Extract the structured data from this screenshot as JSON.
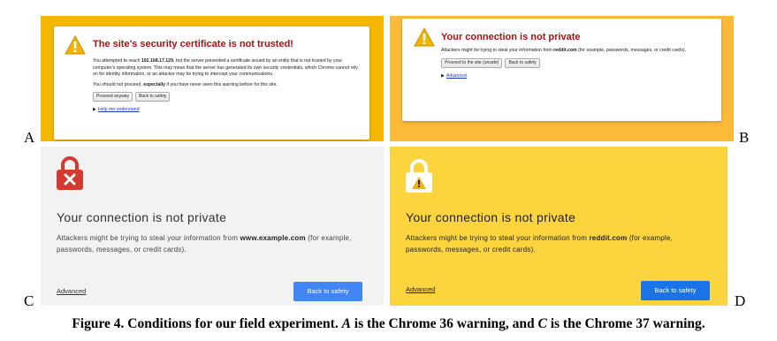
{
  "panels": {
    "a": {
      "title": "The site's security certificate is not trusted!",
      "para1_pre": "You attempted to reach ",
      "para1_ip": "192.168.17.129",
      "para1_post": ", but the server presented a certificate issued by an entity that is not trusted by your computer's operating system. This may mean that the server has generated its own security credentials, which Chrome cannot rely on for identity information, or an attacker may be trying to intercept your communications.",
      "para2_pre": "You should not proceed, ",
      "para2_bold": "especially",
      "para2_post": " if you have never seen this warning before for this site.",
      "proceed_button": "Proceed anyway",
      "back_button": "Back to safety",
      "help_link": "Help me understand"
    },
    "b": {
      "title": "Your connection is not private",
      "body_pre": "Attackers might be trying to steal your information from ",
      "body_site": "reddit.com",
      "body_post": " (for example, passwords, messages, or credit cards).",
      "proceed_button": "Proceed to the site (unsafe)",
      "back_button": "Back to safety",
      "advanced_link": "Advanced"
    },
    "c": {
      "title": "Your connection is not private",
      "body_pre": "Attackers might be trying to steal your information from ",
      "body_site": "www.example.com",
      "body_post": " (for example, passwords, messages, or credit cards).",
      "advanced_link": "Advanced",
      "back_button": "Back to safety"
    },
    "d": {
      "title": "Your connection is not private",
      "body_pre": "Attackers might be trying to steal your information from ",
      "body_site": "reddit.com",
      "body_post": " (for example, passwords, messages, or credit cards).",
      "advanced_link": "Advanced",
      "back_button": "Back to safety"
    }
  },
  "letters": {
    "a": "A",
    "b": "B",
    "c": "C",
    "d": "D"
  },
  "caption": {
    "part1": "Figure 4. Conditions for our field experiment. ",
    "a": "A",
    "part2": " is the Chrome 36 warning, and ",
    "c": "C",
    "part3": " is the Chrome 37 warning."
  },
  "icons": {
    "panel_a": "warning-triangle-icon",
    "panel_b": "warning-triangle-icon",
    "panel_c": "red-lock-x-icon",
    "panel_d": "yellow-lock-exclamation-icon"
  },
  "colors": {
    "panel_a_frame": "#f5b800",
    "panel_b_frame": "#fbbb38",
    "panel_c_bg": "#f2f2f2",
    "panel_d_bg": "#fbd43e",
    "title_red": "#b01010",
    "lock_red": "#d43b30",
    "button_blue": "#4285f4"
  }
}
